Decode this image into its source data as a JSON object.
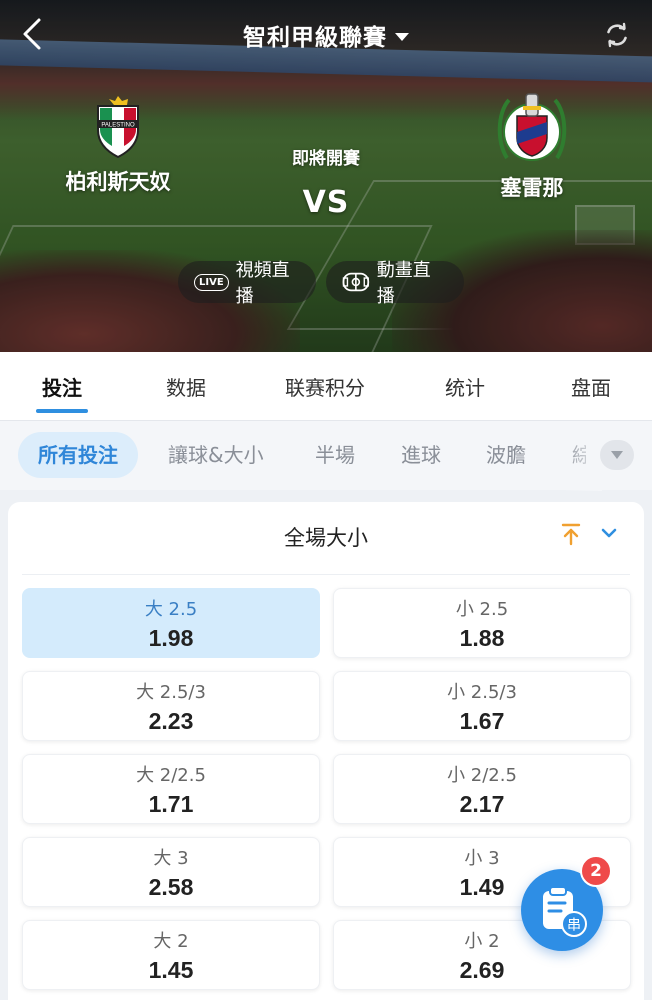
{
  "header": {
    "league_title": "智利甲級聯賽",
    "status": "即將開賽",
    "vs": "VS",
    "home_team": "柏利斯天奴",
    "away_team": "塞雷那",
    "home_crest_text": "PALESTINO",
    "live_video_badge": "LIVE",
    "live_video_label": "視頻直播",
    "live_animation_label": "動畫直播"
  },
  "main_tabs": [
    "投注",
    "数据",
    "联赛积分",
    "统计",
    "盘面"
  ],
  "sub_tabs": [
    "所有投注",
    "讓球&大小",
    "半場",
    "進球",
    "波膽",
    "綜"
  ],
  "market": {
    "title": "全場大小",
    "odds": [
      {
        "label": "大 2.5",
        "value": "1.98",
        "selected": true
      },
      {
        "label": "小 2.5",
        "value": "1.88"
      },
      {
        "label": "大 2.5/3",
        "value": "2.23"
      },
      {
        "label": "小 2.5/3",
        "value": "1.67"
      },
      {
        "label": "大 2/2.5",
        "value": "1.71"
      },
      {
        "label": "小 2/2.5",
        "value": "2.17"
      },
      {
        "label": "大 3",
        "value": "2.58"
      },
      {
        "label": "小 3",
        "value": "1.49"
      },
      {
        "label": "大 2",
        "value": "1.45"
      },
      {
        "label": "小 2",
        "value": "2.69"
      }
    ]
  },
  "betslip": {
    "count": "2",
    "glyph": "串"
  },
  "colors": {
    "accent": "#2f8fe0",
    "selected_bg": "#d4ebfc",
    "badge": "#ef4a4a",
    "pin": "#f0a030"
  }
}
